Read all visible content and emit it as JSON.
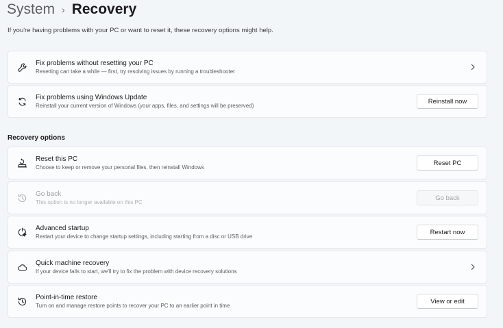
{
  "header": {
    "parent": "System",
    "separator": "›",
    "current": "Recovery"
  },
  "intro": "If you're having problems with your PC or want to reset it, these recovery options might help.",
  "top_cards": [
    {
      "icon": "wrench-icon",
      "title": "Fix problems without resetting your PC",
      "desc": "Resetting can take a while — first, try resolving issues by running a troubleshooter",
      "action": "chevron"
    },
    {
      "icon": "sync-icon",
      "title": "Fix problems using Windows Update",
      "desc": "Reinstall your current version of Windows (your apps, files, and settings will be preserved)",
      "button": "Reinstall now"
    }
  ],
  "section_title": "Recovery options",
  "recovery_cards": [
    {
      "icon": "reset-pc-icon",
      "title": "Reset this PC",
      "desc": "Choose to keep or remove your personal files, then reinstall Windows",
      "button": "Reset PC"
    },
    {
      "icon": "history-icon",
      "title": "Go back",
      "desc": "This option is no longer available on this PC",
      "button": "Go back",
      "disabled": true
    },
    {
      "icon": "advanced-startup-icon",
      "title": "Advanced startup",
      "desc": "Restart your device to change startup settings, including starting from a disc or USB drive",
      "button": "Restart now"
    },
    {
      "icon": "cloud-icon",
      "title": "Quick machine recovery",
      "desc": "If your device fails to start, we'll try to fix the problem with device recovery solutions",
      "action": "chevron"
    },
    {
      "icon": "restore-icon",
      "title": "Point-in-time restore",
      "desc": "Turn on and manage restore points to recover your PC to an earlier point in time",
      "button": "View or edit"
    }
  ],
  "colors": {
    "background": "#f3f6f9",
    "card": "#fbfcfd",
    "border": "#e4e7ea",
    "disabled_text": "#a3a3a3"
  }
}
